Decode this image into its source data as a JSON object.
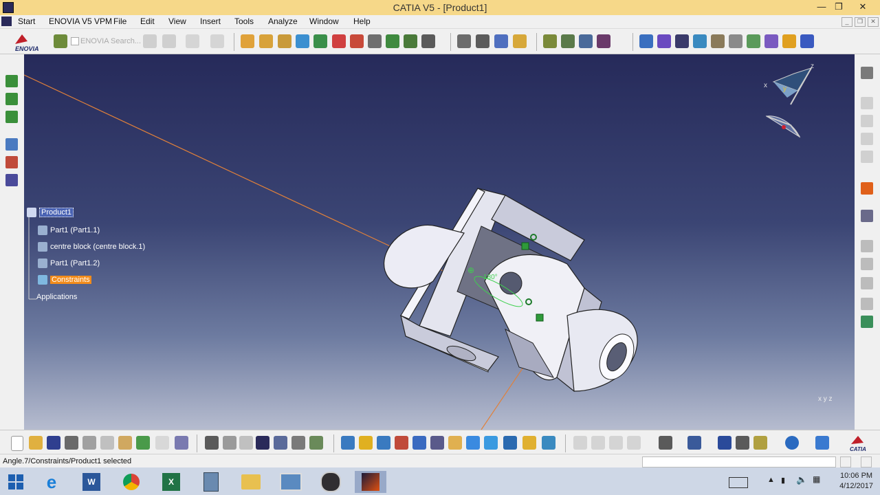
{
  "window": {
    "title": "CATIA V5 - [Product1]"
  },
  "menu": [
    {
      "label": "Start"
    },
    {
      "label": "ENOVIA V5 VPM"
    },
    {
      "label": "File"
    },
    {
      "label": "Edit"
    },
    {
      "label": "View"
    },
    {
      "label": "Insert"
    },
    {
      "label": "Tools"
    },
    {
      "label": "Analyze"
    },
    {
      "label": "Window"
    },
    {
      "label": "Help"
    }
  ],
  "toolbar": {
    "enovia_logo": "ENOVIA",
    "search_label": "ENOVIA Search..."
  },
  "tree": {
    "root": "Product1",
    "items": [
      {
        "label": "Part1 (Part1.1)"
      },
      {
        "label": "centre block (centre block.1)"
      },
      {
        "label": "Part1 (Part1.2)"
      },
      {
        "label": "Constraints"
      },
      {
        "label": "Applications"
      }
    ]
  },
  "viewport": {
    "compass": {
      "x": "x",
      "y": "y",
      "z": "z"
    },
    "angle_label": "180°",
    "corner_axes": "x y z"
  },
  "status": {
    "text": "Angle.7/Constraints/Product1 selected"
  },
  "catia_logo": "CATIA",
  "taskbar": {
    "apps": [
      "start-icon",
      "ie-icon",
      "word-icon",
      "chrome-icon",
      "excel-icon",
      "calculator-icon",
      "explorer-icon",
      "photos-icon",
      "obs-icon",
      "catia-icon"
    ],
    "time": "10:06 PM",
    "date": "4/12/2017"
  },
  "colors": {
    "titlebar": "#f6d889",
    "viewport_top": "#262a5a",
    "viewport_bottom": "#b6bccf",
    "selection_orange": "#f28c1b"
  }
}
